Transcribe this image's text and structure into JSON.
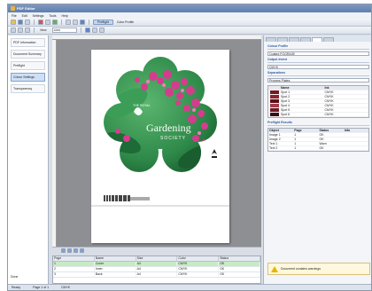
{
  "window": {
    "title": "PDF Editor"
  },
  "menu": [
    "File",
    "Edit",
    "Settings",
    "Tools",
    "Help"
  ],
  "toolbar": {
    "view_label": "View",
    "pill_label": "Preflight",
    "pill2_label": "Color Profile",
    "zoom_value": "100%"
  },
  "left_panel": {
    "items": [
      {
        "label": "PDF Information"
      },
      {
        "label": "Document Summary"
      },
      {
        "label": "Preflight"
      },
      {
        "label": "Colour Settings"
      },
      {
        "label": "Transparency"
      }
    ],
    "footer": "Done"
  },
  "document": {
    "cover_title": "Gardening",
    "cover_subtitle": "SOCIETY",
    "cover_top": "THE ROYAL",
    "colors": {
      "flower_pink": "#d63c8e",
      "leaf_green": "#2f8a4a",
      "dark_green": "#145a2b",
      "white": "#ffffff"
    }
  },
  "right_panel": {
    "sections": {
      "profile_head": "Colour Profile",
      "profile_value": "Coated FOGRA39",
      "output_head": "Output Intent",
      "output_value": "CMYK",
      "separations_head": "Separations",
      "separations_value": "Process Plates"
    },
    "swatches_header": [
      "Name",
      "Ink"
    ],
    "swatches": [
      {
        "name": "Spot 1",
        "ink": "CMYK",
        "color": "#7a1820"
      },
      {
        "name": "Spot 2",
        "ink": "CMYK",
        "color": "#8e2130"
      },
      {
        "name": "Spot 3",
        "ink": "CMYK",
        "color": "#5b1018"
      },
      {
        "name": "Spot 4",
        "ink": "CMYK",
        "color": "#a33a48"
      },
      {
        "name": "Spot 5",
        "ink": "CMYK",
        "color": "#6c1a24"
      },
      {
        "name": "Spot 6",
        "ink": "CMYK",
        "color": "#3f0b12"
      }
    ],
    "results_head": "Preflight Results",
    "results_header": [
      "Object",
      "Page",
      "Status",
      "Info"
    ],
    "results": [
      [
        "Image 1",
        "1",
        "OK",
        ""
      ],
      [
        "Image 2",
        "1",
        "OK",
        ""
      ],
      [
        "Text 1",
        "1",
        "Warn",
        ""
      ],
      [
        "Text 2",
        "1",
        "OK",
        ""
      ]
    ],
    "warning_text": "Document contains warnings"
  },
  "bottom_table": {
    "header": [
      "Page",
      "Name",
      "Size",
      "Color",
      "Status"
    ],
    "rows": [
      [
        "1",
        "Cover",
        "A4",
        "CMYK",
        "OK"
      ],
      [
        "2",
        "Inner",
        "A4",
        "CMYK",
        "OK"
      ],
      [
        "3",
        "Back",
        "A4",
        "CMYK",
        "OK"
      ]
    ]
  },
  "status": [
    "Ready",
    "Page 1 of 1",
    "CMYK"
  ]
}
